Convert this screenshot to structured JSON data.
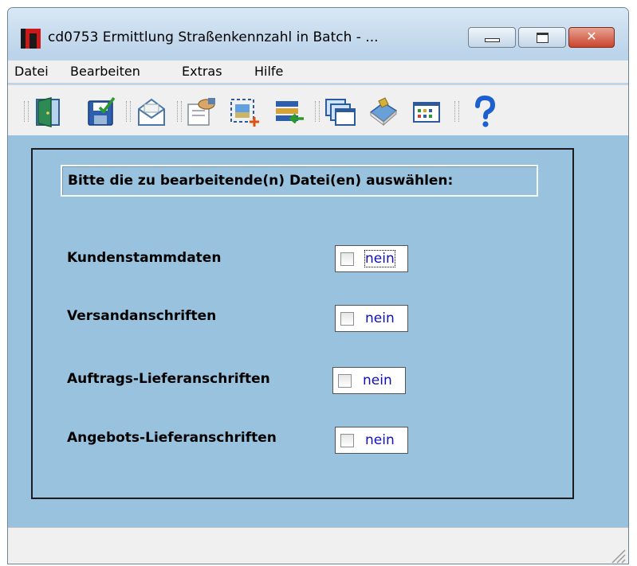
{
  "window": {
    "title": "cd0753 Ermittlung Straßenkennzahl in Batch - ..."
  },
  "title_buttons": {
    "minimize_icon": "minimize-icon",
    "maximize_icon": "maximize-icon",
    "close_icon": "close-icon",
    "close_glyph": "✕"
  },
  "menu": [
    "Datei",
    "Bearbeiten",
    "Extras",
    "Hilfe"
  ],
  "toolbar": {
    "icons": [
      "exit-door-icon",
      "save-icon",
      "mail-icon",
      "edit-hand-icon",
      "add-selection-icon",
      "import-list-icon",
      "windows-icon",
      "book-icon",
      "grid-view-icon",
      "help-icon"
    ]
  },
  "form": {
    "heading": "Bitte die zu bearbeitende(n) Datei(en) auswählen:",
    "rows": [
      {
        "label": "Kundenstammdaten",
        "checked": false,
        "value": "nein",
        "focused": true
      },
      {
        "label": "Versandanschriften",
        "checked": false,
        "value": "nein",
        "focused": false
      },
      {
        "label": "Auftrags-Lieferanschriften",
        "checked": false,
        "value": "nein",
        "focused": false
      },
      {
        "label": "Angebots-Lieferanschriften",
        "checked": false,
        "value": "nein",
        "focused": false
      }
    ]
  },
  "colors": {
    "client_bg": "#98c2dd",
    "checkbox_text": "#1010b8",
    "close_button": "#c9452d"
  }
}
